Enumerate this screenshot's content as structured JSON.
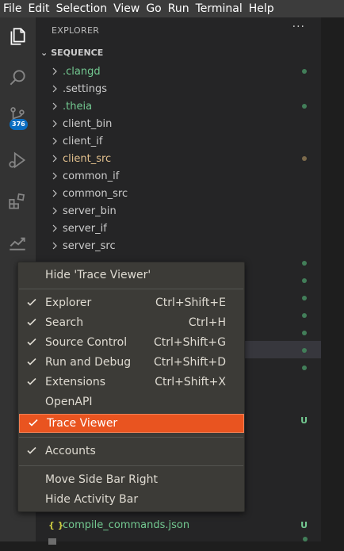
{
  "menubar": [
    "File",
    "Edit",
    "Selection",
    "View",
    "Go",
    "Run",
    "Terminal",
    "Help"
  ],
  "activity": {
    "badge": "376"
  },
  "sidebar": {
    "header": "EXPLORER",
    "more": "···",
    "section": "SEQUENCE",
    "folders": [
      {
        "name": ".clangd",
        "color": "#73c991",
        "mark": "dot",
        "mark_color": "#427e59"
      },
      {
        "name": ".settings",
        "color": "#cccccc",
        "mark": "",
        "mark_color": ""
      },
      {
        "name": ".theia",
        "color": "#73c991",
        "mark": "dot",
        "mark_color": "#427e59"
      },
      {
        "name": "client_bin",
        "color": "#cccccc",
        "mark": "",
        "mark_color": ""
      },
      {
        "name": "client_if",
        "color": "#cccccc",
        "mark": "",
        "mark_color": ""
      },
      {
        "name": "client_src",
        "color": "#e2c08d",
        "mark": "dot",
        "mark_color": "#7c6a4b"
      },
      {
        "name": "common_if",
        "color": "#cccccc",
        "mark": "",
        "mark_color": ""
      },
      {
        "name": "common_src",
        "color": "#cccccc",
        "mark": "",
        "mark_color": ""
      },
      {
        "name": "server_bin",
        "color": "#cccccc",
        "mark": "",
        "mark_color": ""
      },
      {
        "name": "server_if",
        "color": "#cccccc",
        "mark": "",
        "mark_color": ""
      },
      {
        "name": "server_src",
        "color": "#cccccc",
        "mark": "",
        "mark_color": ""
      }
    ],
    "hidden_marks": [
      {
        "mark": "dot"
      },
      {
        "mark": "dot"
      },
      {
        "mark": "dot"
      },
      {
        "mark": "dot"
      },
      {
        "mark": "dot"
      },
      {
        "mark": "dot"
      },
      {
        "mark": "dot"
      },
      {
        "mark": ""
      },
      {
        "mark": ""
      },
      {
        "mark": "U"
      }
    ],
    "bottom_files": [
      {
        "icon": "{ }",
        "name": "compile_commands.json",
        "status": "U"
      }
    ]
  },
  "context_menu": {
    "hide_item": "Hide 'Trace Viewer'",
    "views": [
      {
        "label": "Explorer",
        "shortcut": "Ctrl+Shift+E",
        "checked": true
      },
      {
        "label": "Search",
        "shortcut": "Ctrl+H",
        "checked": true
      },
      {
        "label": "Source Control",
        "shortcut": "Ctrl+Shift+G",
        "checked": true
      },
      {
        "label": "Run and Debug",
        "shortcut": "Ctrl+Shift+D",
        "checked": true
      },
      {
        "label": "Extensions",
        "shortcut": "Ctrl+Shift+X",
        "checked": true
      },
      {
        "label": "OpenAPI",
        "shortcut": "",
        "checked": false
      },
      {
        "label": "Trace Viewer",
        "shortcut": "",
        "checked": true,
        "active": true
      }
    ],
    "accounts": "Accounts",
    "move_sidebar": "Move Side Bar Right",
    "hide_activity": "Hide Activity Bar"
  },
  "colors": {
    "accent": "#e95420",
    "git_added": "#73c991",
    "git_modified": "#e2c08d",
    "badge": "#0a6dc2"
  }
}
